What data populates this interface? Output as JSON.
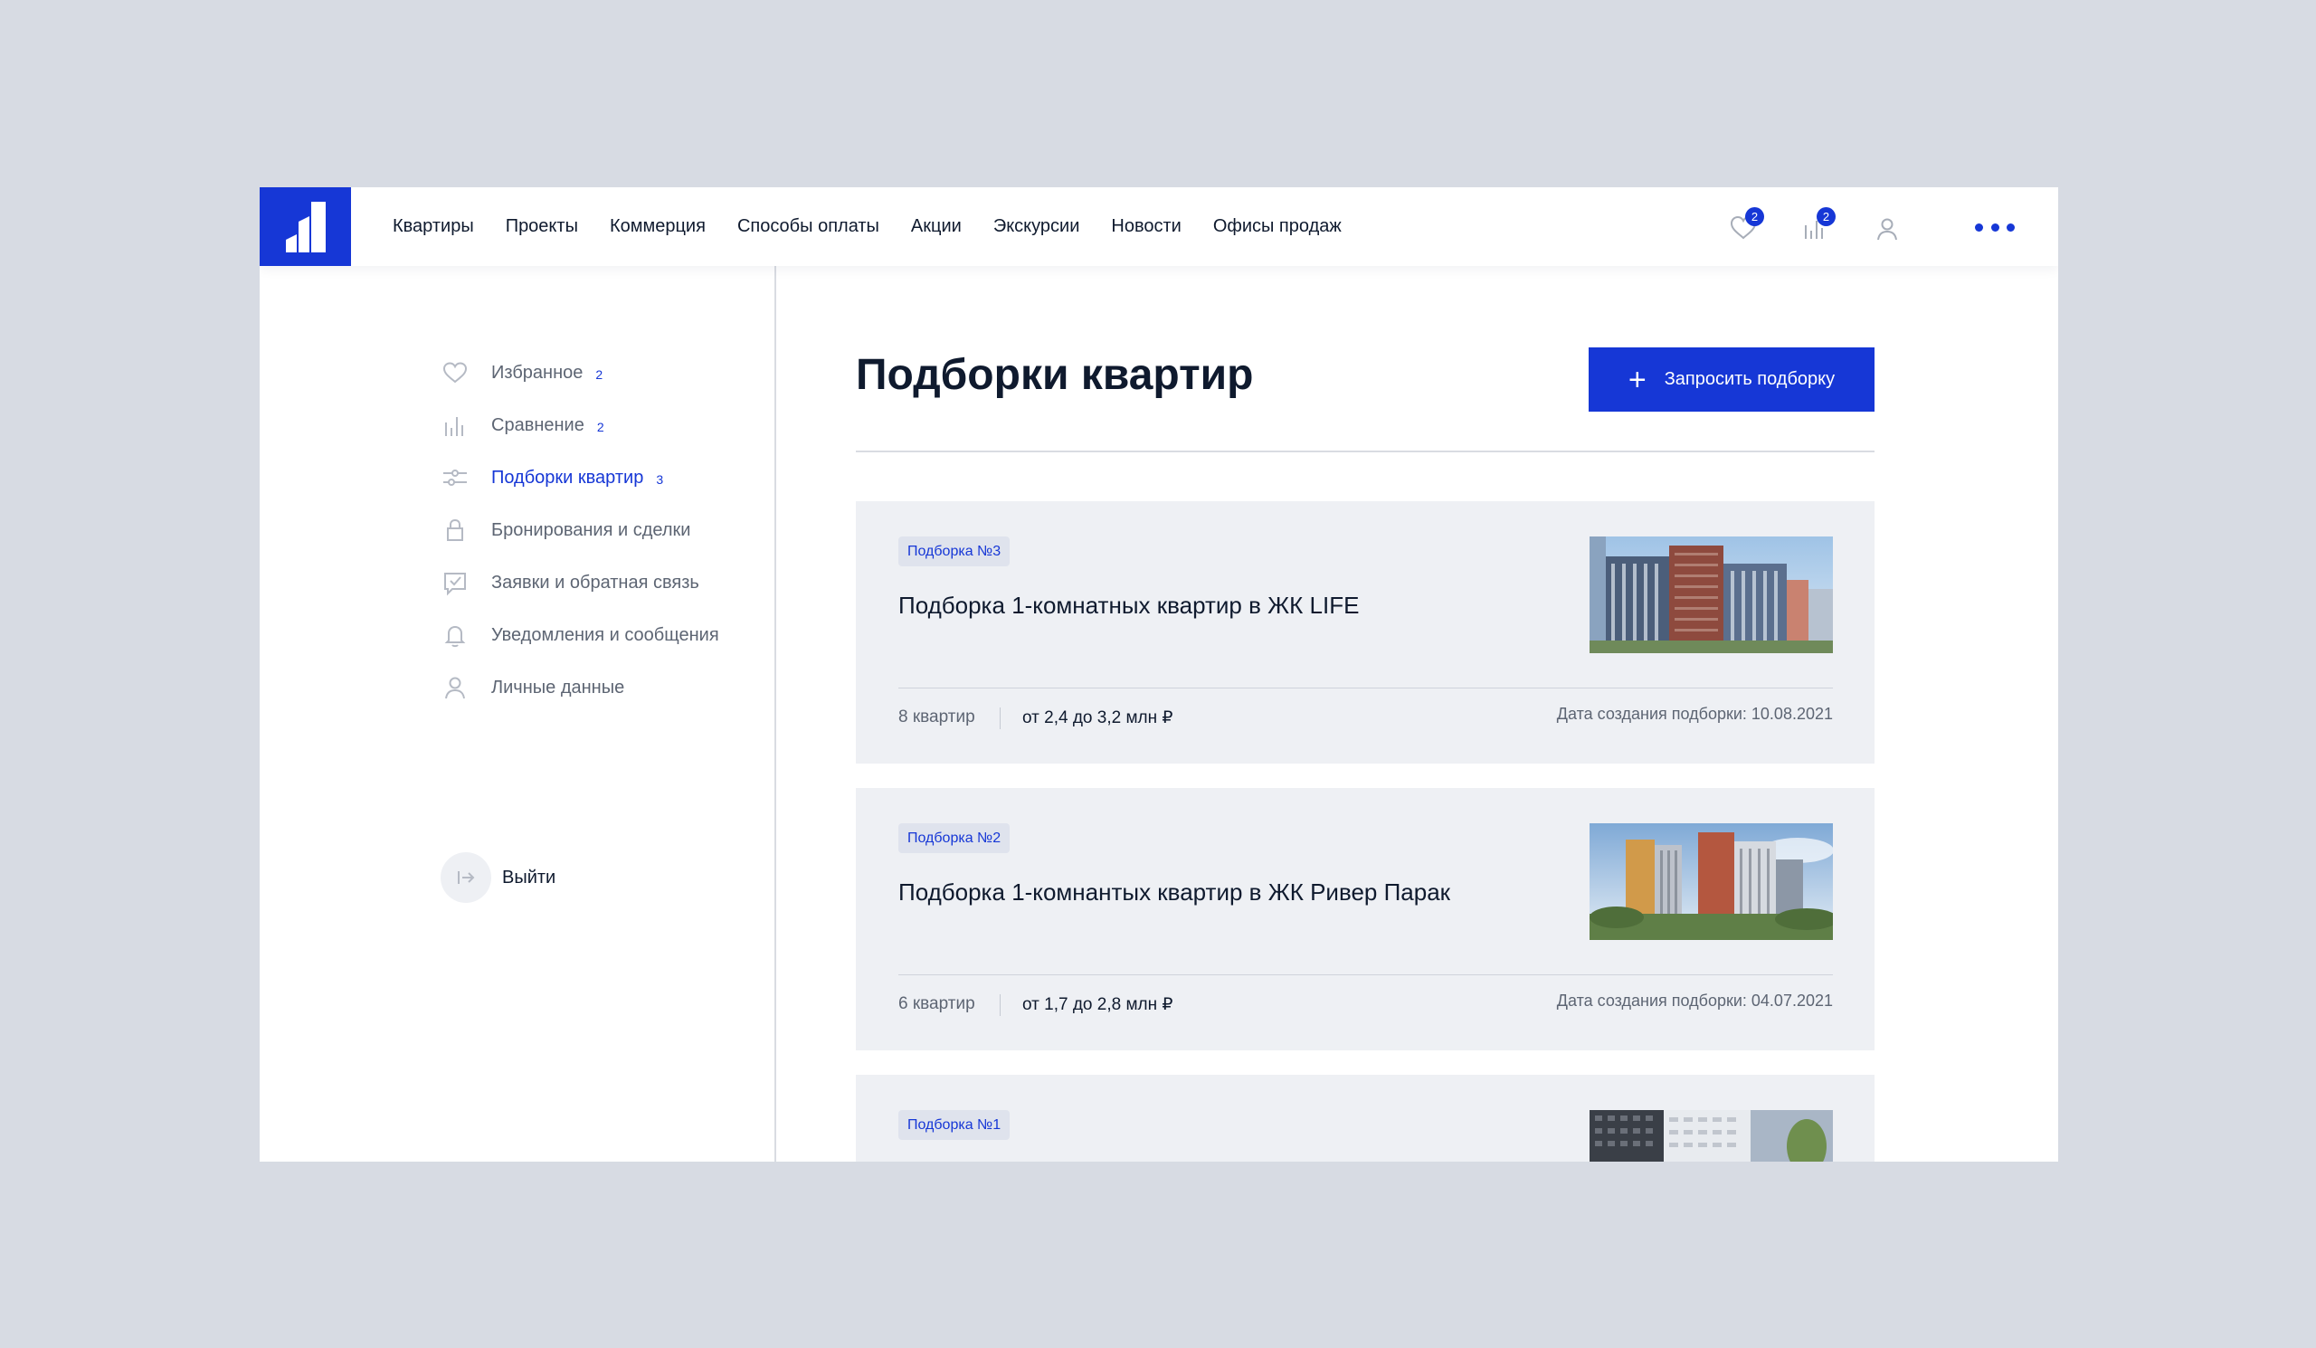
{
  "header": {
    "nav": [
      "Квартиры",
      "Проекты",
      "Коммерция",
      "Способы оплаты",
      "Акции",
      "Экскурсии",
      "Новости",
      "Офисы продаж"
    ],
    "favorites_badge": "2",
    "compare_badge": "2",
    "accent_color": "#1637d6"
  },
  "sidebar": {
    "items": [
      {
        "label": "Избранное",
        "count": "2",
        "icon": "heart-icon"
      },
      {
        "label": "Сравнение",
        "count": "2",
        "icon": "chart-bars-icon"
      },
      {
        "label": "Подборки квартир",
        "count": "3",
        "icon": "sliders-icon",
        "active": true
      },
      {
        "label": "Бронирования и сделки",
        "count": "",
        "icon": "lock-icon"
      },
      {
        "label": "Заявки и обратная связь",
        "count": "",
        "icon": "checkbox-icon"
      },
      {
        "label": "Уведомления и сообщения",
        "count": "",
        "icon": "bell-icon"
      },
      {
        "label": "Личные данные",
        "count": "",
        "icon": "user-icon"
      }
    ],
    "logout_label": "Выйти"
  },
  "main": {
    "title": "Подборки квартир",
    "request_button": "Запросить подборку",
    "cards": [
      {
        "tag": "Подборка №3",
        "title": "Подборка 1-комнатных квартир в ЖК LIFE",
        "count": "8 квартир",
        "price": "от 2,4 до 3,2 млн ₽",
        "date": "Дата создания подборки: 10.08.2021"
      },
      {
        "tag": "Подборка №2",
        "title": "Подборка 1-комнантых квартир в ЖК Ривер Парак",
        "count": "6 квартир",
        "price": "от 1,7 до 2,8 млн ₽",
        "date": "Дата создания подборки: 04.07.2021"
      },
      {
        "tag": "Подборка №1",
        "title": "",
        "count": "",
        "price": "",
        "date": ""
      }
    ]
  }
}
